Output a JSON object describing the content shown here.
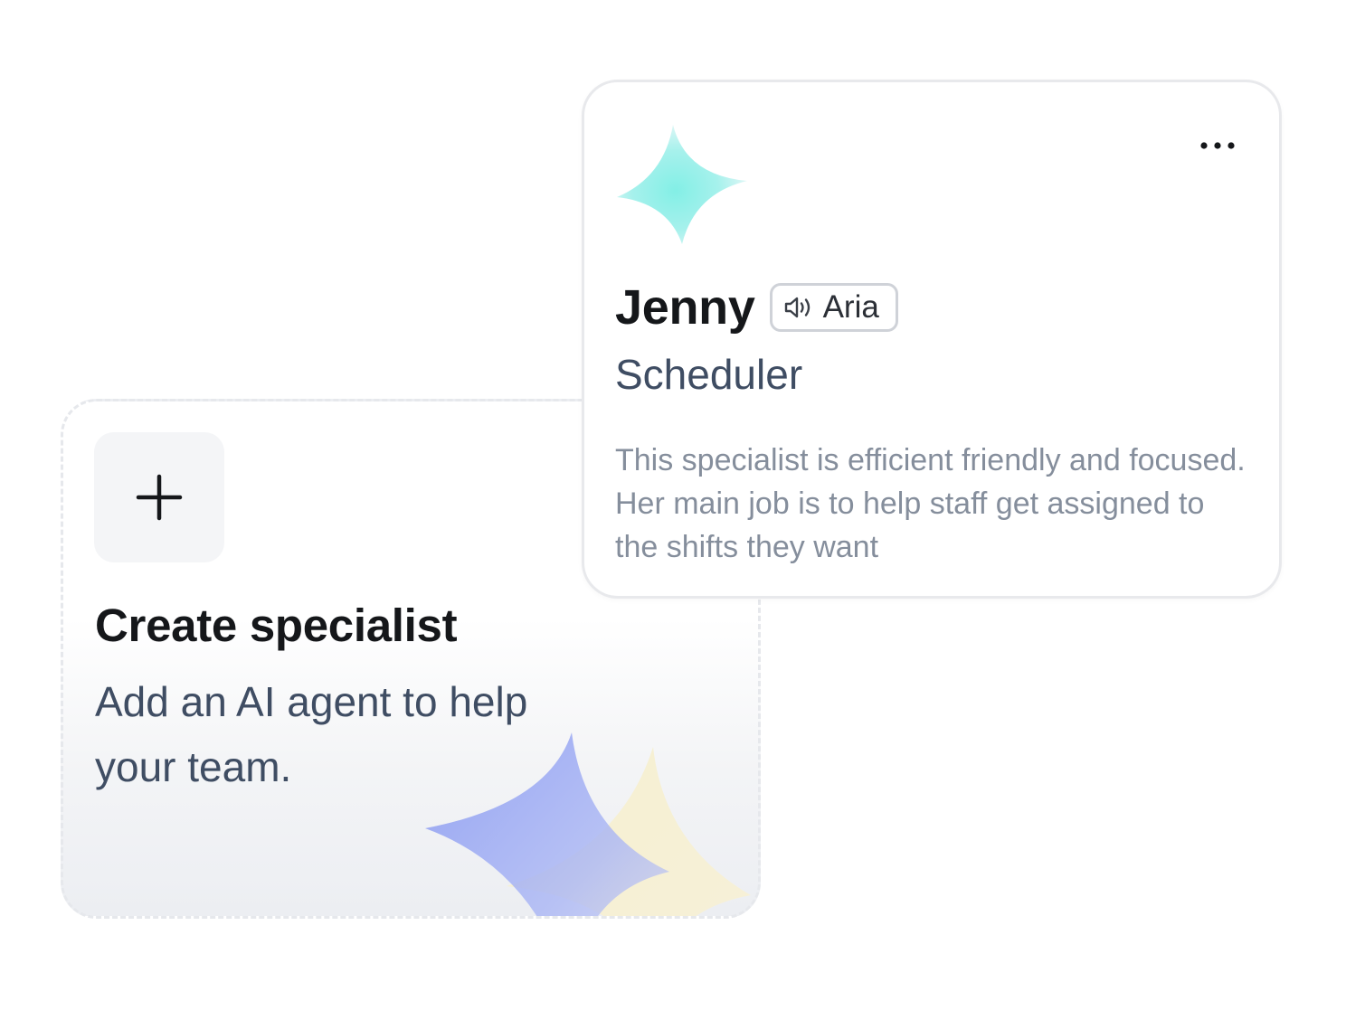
{
  "create_card": {
    "title": "Create specialist",
    "subtitle": "Add an AI agent to help your team.",
    "icon": "plus-icon"
  },
  "specialist": {
    "name": "Jenny",
    "voice": {
      "icon": "speaker-icon",
      "label": "Aria"
    },
    "role": "Scheduler",
    "description": "This specialist is efficient friendly and focused. Her main job is to help staff get assigned to the shifts they want",
    "menu_icon": "more-horizontal-icon"
  },
  "colors": {
    "title": "#15171a",
    "subtitle": "#3f4d63",
    "description": "#858e9c",
    "avatar_teal": "#8ef0e8",
    "decor_blue": "#9aa8f3",
    "decor_yellow": "#f7efcf"
  }
}
